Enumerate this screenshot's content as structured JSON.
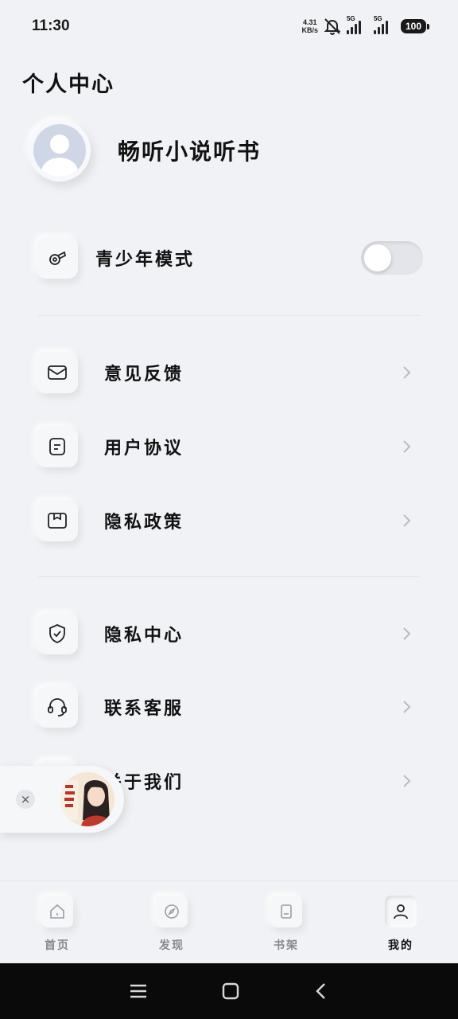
{
  "status_bar": {
    "time": "11:30",
    "net_speed_value": "4.31",
    "net_speed_unit": "KB/s",
    "signal_1_label": "5G",
    "signal_2_label": "5G",
    "battery": "100"
  },
  "page_title": "个人中心",
  "profile": {
    "username": "畅听小说听书",
    "avatar_icon": "default-user-avatar"
  },
  "youth_mode": {
    "label": "青少年模式",
    "icon": "whistle-icon",
    "enabled": false
  },
  "menu_group_1": [
    {
      "label": "意见反馈",
      "icon": "mail-icon"
    },
    {
      "label": "用户协议",
      "icon": "document-icon"
    },
    {
      "label": "隐私政策",
      "icon": "privacy-folder-icon"
    }
  ],
  "menu_group_2": [
    {
      "label": "隐私中心",
      "icon": "shield-check-icon"
    },
    {
      "label": "联系客服",
      "icon": "headset-icon"
    },
    {
      "label": "关于我们",
      "icon": "info-icon"
    }
  ],
  "floating_player": {
    "close_label": "×",
    "cover_icon": "book-cover-thumbnail"
  },
  "tabs": [
    {
      "label": "首页",
      "icon": "home-icon",
      "active": false
    },
    {
      "label": "发现",
      "icon": "compass-icon",
      "active": false
    },
    {
      "label": "书架",
      "icon": "bookmark-icon",
      "active": false
    },
    {
      "label": "我的",
      "icon": "user-icon",
      "active": true
    }
  ],
  "colors": {
    "background": "#f1f2f5",
    "text": "#111111",
    "muted": "#888888",
    "nav_bar": "#0a0a0a"
  }
}
